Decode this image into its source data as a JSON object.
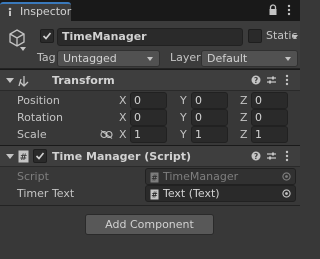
{
  "tab": {
    "title": "Inspector"
  },
  "gameobject": {
    "active": true,
    "name": "TimeManager",
    "static_label": "Static",
    "static": false,
    "tag_label": "Tag",
    "tag_value": "Untagged",
    "layer_label": "Layer",
    "layer_value": "Default"
  },
  "transform": {
    "title": "Transform",
    "rows": [
      {
        "label": "Position",
        "x": "0",
        "y": "0",
        "z": "0"
      },
      {
        "label": "Rotation",
        "x": "0",
        "y": "0",
        "z": "0"
      },
      {
        "label": "Scale",
        "x": "1",
        "y": "1",
        "z": "1"
      }
    ],
    "axes": {
      "x": "X",
      "y": "Y",
      "z": "Z"
    }
  },
  "script_component": {
    "title": "Time Manager (Script)",
    "enabled": true,
    "script_label": "Script",
    "script_value": "TimeManager",
    "timer_label": "Timer Text",
    "timer_value": "Text (Text)"
  },
  "add_component": {
    "label": "Add Component"
  },
  "colors": {
    "background": "#383838",
    "tab_accent": "#3a79bb",
    "field": "#2a2a2a"
  },
  "icons": [
    "inspector-icon",
    "lock-icon",
    "menu-icon",
    "cube-icon",
    "checkmark-icon",
    "transform-icon",
    "help-icon",
    "preset-icon",
    "overflow-icon",
    "script-icon",
    "link-icon",
    "text-component-icon",
    "object-picker-icon"
  ]
}
